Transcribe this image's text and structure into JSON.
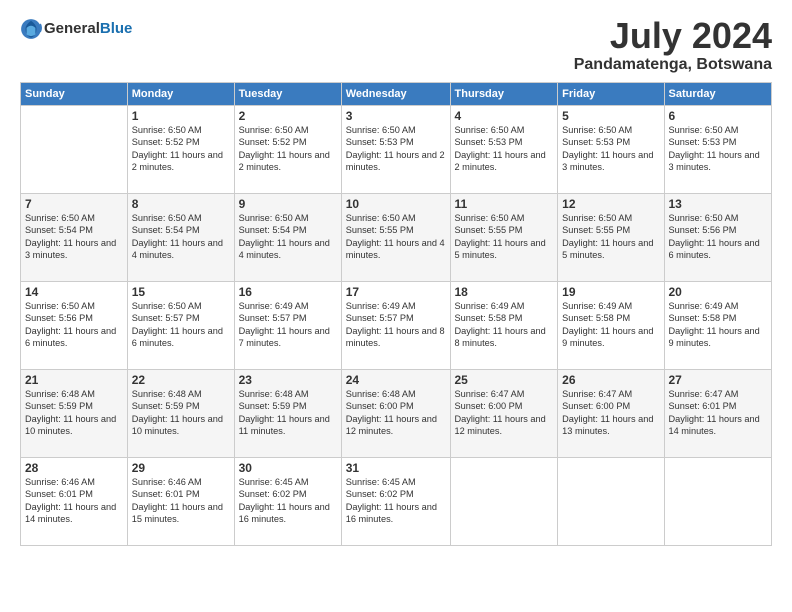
{
  "header": {
    "logo": {
      "general": "General",
      "blue": "Blue"
    },
    "title": "July 2024",
    "location": "Pandamatenga, Botswana"
  },
  "days_of_week": [
    "Sunday",
    "Monday",
    "Tuesday",
    "Wednesday",
    "Thursday",
    "Friday",
    "Saturday"
  ],
  "weeks": [
    [
      {
        "day": "",
        "sunrise": "",
        "sunset": "",
        "daylight": ""
      },
      {
        "day": "1",
        "sunrise": "Sunrise: 6:50 AM",
        "sunset": "Sunset: 5:52 PM",
        "daylight": "Daylight: 11 hours and 2 minutes."
      },
      {
        "day": "2",
        "sunrise": "Sunrise: 6:50 AM",
        "sunset": "Sunset: 5:52 PM",
        "daylight": "Daylight: 11 hours and 2 minutes."
      },
      {
        "day": "3",
        "sunrise": "Sunrise: 6:50 AM",
        "sunset": "Sunset: 5:53 PM",
        "daylight": "Daylight: 11 hours and 2 minutes."
      },
      {
        "day": "4",
        "sunrise": "Sunrise: 6:50 AM",
        "sunset": "Sunset: 5:53 PM",
        "daylight": "Daylight: 11 hours and 2 minutes."
      },
      {
        "day": "5",
        "sunrise": "Sunrise: 6:50 AM",
        "sunset": "Sunset: 5:53 PM",
        "daylight": "Daylight: 11 hours and 3 minutes."
      },
      {
        "day": "6",
        "sunrise": "Sunrise: 6:50 AM",
        "sunset": "Sunset: 5:53 PM",
        "daylight": "Daylight: 11 hours and 3 minutes."
      }
    ],
    [
      {
        "day": "7",
        "sunrise": "Sunrise: 6:50 AM",
        "sunset": "Sunset: 5:54 PM",
        "daylight": "Daylight: 11 hours and 3 minutes."
      },
      {
        "day": "8",
        "sunrise": "Sunrise: 6:50 AM",
        "sunset": "Sunset: 5:54 PM",
        "daylight": "Daylight: 11 hours and 4 minutes."
      },
      {
        "day": "9",
        "sunrise": "Sunrise: 6:50 AM",
        "sunset": "Sunset: 5:54 PM",
        "daylight": "Daylight: 11 hours and 4 minutes."
      },
      {
        "day": "10",
        "sunrise": "Sunrise: 6:50 AM",
        "sunset": "Sunset: 5:55 PM",
        "daylight": "Daylight: 11 hours and 4 minutes."
      },
      {
        "day": "11",
        "sunrise": "Sunrise: 6:50 AM",
        "sunset": "Sunset: 5:55 PM",
        "daylight": "Daylight: 11 hours and 5 minutes."
      },
      {
        "day": "12",
        "sunrise": "Sunrise: 6:50 AM",
        "sunset": "Sunset: 5:55 PM",
        "daylight": "Daylight: 11 hours and 5 minutes."
      },
      {
        "day": "13",
        "sunrise": "Sunrise: 6:50 AM",
        "sunset": "Sunset: 5:56 PM",
        "daylight": "Daylight: 11 hours and 6 minutes."
      }
    ],
    [
      {
        "day": "14",
        "sunrise": "Sunrise: 6:50 AM",
        "sunset": "Sunset: 5:56 PM",
        "daylight": "Daylight: 11 hours and 6 minutes."
      },
      {
        "day": "15",
        "sunrise": "Sunrise: 6:50 AM",
        "sunset": "Sunset: 5:57 PM",
        "daylight": "Daylight: 11 hours and 6 minutes."
      },
      {
        "day": "16",
        "sunrise": "Sunrise: 6:49 AM",
        "sunset": "Sunset: 5:57 PM",
        "daylight": "Daylight: 11 hours and 7 minutes."
      },
      {
        "day": "17",
        "sunrise": "Sunrise: 6:49 AM",
        "sunset": "Sunset: 5:57 PM",
        "daylight": "Daylight: 11 hours and 8 minutes."
      },
      {
        "day": "18",
        "sunrise": "Sunrise: 6:49 AM",
        "sunset": "Sunset: 5:58 PM",
        "daylight": "Daylight: 11 hours and 8 minutes."
      },
      {
        "day": "19",
        "sunrise": "Sunrise: 6:49 AM",
        "sunset": "Sunset: 5:58 PM",
        "daylight": "Daylight: 11 hours and 9 minutes."
      },
      {
        "day": "20",
        "sunrise": "Sunrise: 6:49 AM",
        "sunset": "Sunset: 5:58 PM",
        "daylight": "Daylight: 11 hours and 9 minutes."
      }
    ],
    [
      {
        "day": "21",
        "sunrise": "Sunrise: 6:48 AM",
        "sunset": "Sunset: 5:59 PM",
        "daylight": "Daylight: 11 hours and 10 minutes."
      },
      {
        "day": "22",
        "sunrise": "Sunrise: 6:48 AM",
        "sunset": "Sunset: 5:59 PM",
        "daylight": "Daylight: 11 hours and 10 minutes."
      },
      {
        "day": "23",
        "sunrise": "Sunrise: 6:48 AM",
        "sunset": "Sunset: 5:59 PM",
        "daylight": "Daylight: 11 hours and 11 minutes."
      },
      {
        "day": "24",
        "sunrise": "Sunrise: 6:48 AM",
        "sunset": "Sunset: 6:00 PM",
        "daylight": "Daylight: 11 hours and 12 minutes."
      },
      {
        "day": "25",
        "sunrise": "Sunrise: 6:47 AM",
        "sunset": "Sunset: 6:00 PM",
        "daylight": "Daylight: 11 hours and 12 minutes."
      },
      {
        "day": "26",
        "sunrise": "Sunrise: 6:47 AM",
        "sunset": "Sunset: 6:00 PM",
        "daylight": "Daylight: 11 hours and 13 minutes."
      },
      {
        "day": "27",
        "sunrise": "Sunrise: 6:47 AM",
        "sunset": "Sunset: 6:01 PM",
        "daylight": "Daylight: 11 hours and 14 minutes."
      }
    ],
    [
      {
        "day": "28",
        "sunrise": "Sunrise: 6:46 AM",
        "sunset": "Sunset: 6:01 PM",
        "daylight": "Daylight: 11 hours and 14 minutes."
      },
      {
        "day": "29",
        "sunrise": "Sunrise: 6:46 AM",
        "sunset": "Sunset: 6:01 PM",
        "daylight": "Daylight: 11 hours and 15 minutes."
      },
      {
        "day": "30",
        "sunrise": "Sunrise: 6:45 AM",
        "sunset": "Sunset: 6:02 PM",
        "daylight": "Daylight: 11 hours and 16 minutes."
      },
      {
        "day": "31",
        "sunrise": "Sunrise: 6:45 AM",
        "sunset": "Sunset: 6:02 PM",
        "daylight": "Daylight: 11 hours and 16 minutes."
      },
      {
        "day": "",
        "sunrise": "",
        "sunset": "",
        "daylight": ""
      },
      {
        "day": "",
        "sunrise": "",
        "sunset": "",
        "daylight": ""
      },
      {
        "day": "",
        "sunrise": "",
        "sunset": "",
        "daylight": ""
      }
    ]
  ]
}
